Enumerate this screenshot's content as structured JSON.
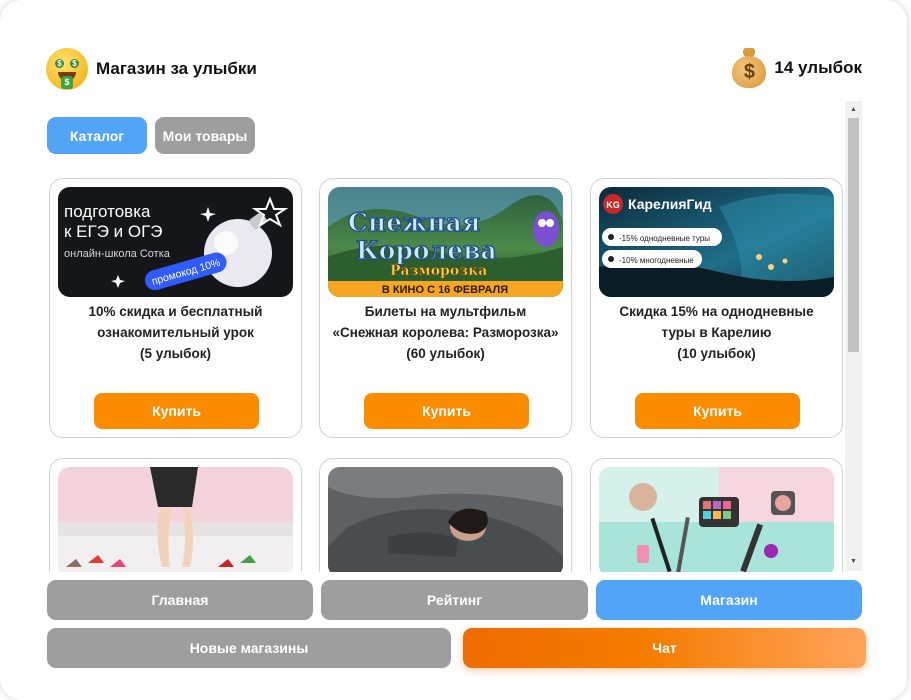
{
  "header": {
    "title": "Магазин за улыбки",
    "balance": "14 улыбок",
    "brand_icon": "money-mouth-face-icon",
    "balance_icon": "money-bag-icon"
  },
  "tabs": [
    {
      "label": "Каталог",
      "active": true
    },
    {
      "label": "Мои товары",
      "active": false
    }
  ],
  "catalog": {
    "buy_label": "Купить",
    "items": [
      {
        "description": "10% скидка и бесплатный ознакомительный урок\n(5 улыбок)",
        "banner": {
          "line1": "подготовка",
          "line2": "к ЕГЭ и ОГЭ",
          "line3": "онлайн-школа Сотка",
          "badge": "промокод 10%"
        }
      },
      {
        "description": "Билеты на мультфильм «Снежная королева: Разморозка»\n(60 улыбок)",
        "banner": {
          "title1": "Снежная",
          "title2": "Королева",
          "subtitle": "Разморозка",
          "ribbon": "В КИНО С 16 ФЕВРАЛЯ"
        }
      },
      {
        "description": "Скидка 15% на однодневные туры в Карелию\n(10 улыбок)",
        "banner": {
          "logo": "КарелияГид",
          "logo_mark": "KG",
          "pill1": "-15% однодневные туры",
          "pill2": "-10% многодневные"
        }
      },
      {
        "description": "",
        "image": "shoes-photo"
      },
      {
        "description": "",
        "image": "sleeping-woman-photo"
      },
      {
        "description": "",
        "image": "cosmetics-photo"
      }
    ]
  },
  "nav": {
    "row1": [
      {
        "label": "Главная",
        "active": false
      },
      {
        "label": "Рейтинг",
        "active": false
      },
      {
        "label": "Магазин",
        "active": true
      }
    ],
    "row2": [
      {
        "label": "Новые магазины"
      },
      {
        "label": "Чат"
      }
    ]
  },
  "colors": {
    "accent_blue": "#52a4f7",
    "buy_orange": "#fb8c00",
    "inactive_gray": "#9e9e9e"
  }
}
